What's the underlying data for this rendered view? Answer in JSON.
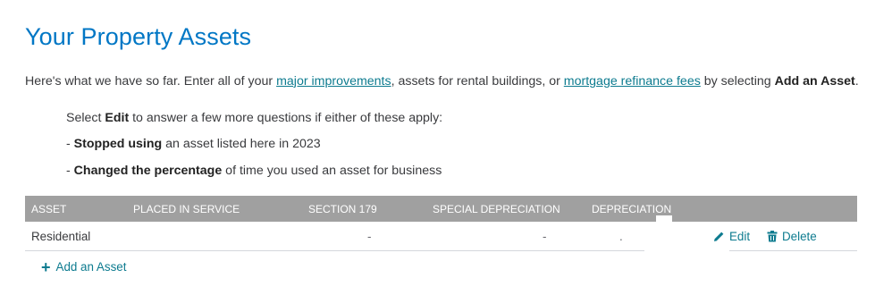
{
  "page": {
    "title": "Your Property Assets",
    "intro": {
      "text1": "Here's what we have so far. Enter all of your ",
      "link1": "major improvements",
      "text2": ", assets for rental buildings, or ",
      "link2": "mortgage refinance fees",
      "text3": " by selecting ",
      "bold": "Add an Asset",
      "text4": "."
    },
    "notes": {
      "line1_pre": "Select ",
      "line1_bold": "Edit",
      "line1_post": " to answer a few more questions if either of these apply:",
      "line2_pre": "- ",
      "line2_bold": "Stopped using",
      "line2_post": " an asset listed here in 2023",
      "line3_pre": "- ",
      "line3_bold": "Changed the percentage",
      "line3_post": " of time you used an asset for business"
    }
  },
  "table": {
    "columns": [
      "ASSET",
      "PLACED IN SERVICE",
      "SECTION 179",
      "SPECIAL DEPRECIATION",
      "DEPRECIATION"
    ],
    "rows": [
      {
        "asset": "Residential",
        "placed_in_service": "",
        "section_179": "-",
        "special_depreciation": "-",
        "depreciation": ".",
        "edit_label": "Edit",
        "delete_label": "Delete"
      }
    ]
  },
  "add_asset_label": "Add an Asset",
  "icons": {
    "edit": "pencil-icon",
    "delete": "trash-icon",
    "add": "plus-icon"
  },
  "colors": {
    "title": "#0077c5",
    "link": "#0d7b8f",
    "header_bg": "#a0a0a0"
  }
}
